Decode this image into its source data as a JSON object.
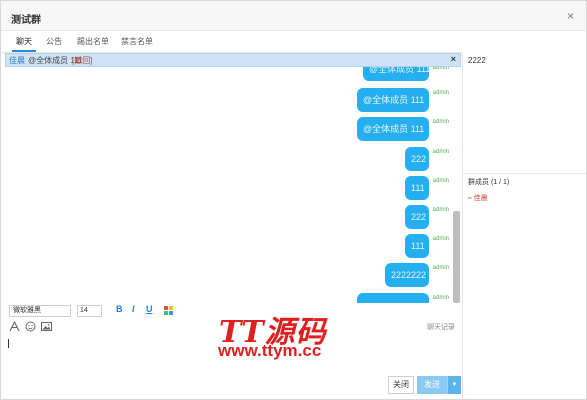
{
  "window": {
    "title": "测试群",
    "close_glyph": "×"
  },
  "tabs": [
    {
      "label": "聊天",
      "active": true
    },
    {
      "label": "公告",
      "active": false
    },
    {
      "label": "踢出名单",
      "active": false
    },
    {
      "label": "禁言名单",
      "active": false
    }
  ],
  "notice_bar": {
    "name": "佳晨",
    "text": "@全体成员 111",
    "recall": "[撤回]",
    "close_glyph": "×"
  },
  "messages": [
    {
      "text": "@全体成员 111",
      "sender": "admin"
    },
    {
      "text": "@全体成员 111",
      "sender": "admin"
    },
    {
      "text": "@全体成员 111",
      "sender": "admin"
    },
    {
      "text": "222",
      "sender": "admin"
    },
    {
      "text": "111",
      "sender": "admin"
    },
    {
      "text": "222",
      "sender": "admin"
    },
    {
      "text": "111",
      "sender": "admin"
    },
    {
      "text": "2222222",
      "sender": "admin"
    },
    {
      "text": "",
      "sender": "admin"
    }
  ],
  "toolbar": {
    "font": "微软雅黑",
    "size": "14",
    "bold": "B",
    "italic": "I",
    "underline": "U",
    "color_icon": "color-palette-icon",
    "history": "聊天记录"
  },
  "toolbar2_icons": [
    "font-icon",
    "emoji-icon",
    "image-icon"
  ],
  "buttons": {
    "close": "关闭",
    "send": "发送",
    "send_dropdown": "▼"
  },
  "side": {
    "notice": "2222",
    "members_title": "群成员 (1 / 1)",
    "member_name": "佳晨",
    "member_icon": "━"
  },
  "watermark": {
    "logo": "TT源码",
    "url": "www.ttym.cc"
  },
  "colors": {
    "bubble": "#25aef0",
    "accent": "#2d89d8",
    "watermark": "#e02020"
  }
}
